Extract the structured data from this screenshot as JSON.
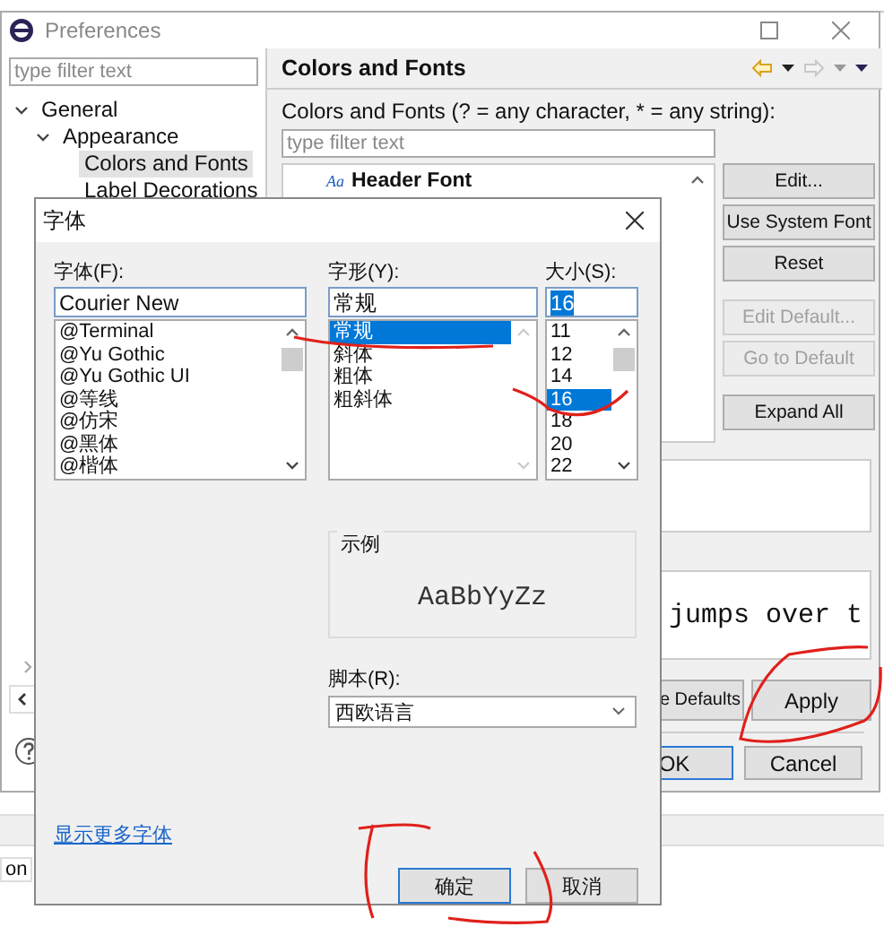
{
  "background": {
    "status_text": "on"
  },
  "preferences": {
    "title": "Preferences",
    "filter": {
      "placeholder": "type filter text"
    },
    "tree": [
      {
        "label": "General",
        "expanded": true,
        "selected": false,
        "children": [
          {
            "label": "Appearance",
            "expanded": true,
            "selected": false,
            "children": [
              {
                "label": "Colors and Fonts",
                "selected": true
              },
              {
                "label": "Label Decorations",
                "selected": false
              }
            ]
          }
        ]
      }
    ],
    "page": {
      "title": "Colors and Fonts",
      "description": "Colors and Fonts (? = any character, * = any string):",
      "filter": {
        "placeholder": "type filter text"
      },
      "items": [
        {
          "icon_text": "Aa",
          "label": "Header Font"
        }
      ],
      "side_buttons": [
        {
          "label": "Edit...",
          "disabled": false
        },
        {
          "label": "Use System Font",
          "disabled": false
        },
        {
          "label": "Reset",
          "disabled": false
        },
        {
          "label": "Edit Default...",
          "disabled": true
        },
        {
          "label": "Go to Default",
          "disabled": true
        },
        {
          "label": "Expand All",
          "disabled": false
        }
      ],
      "preview_text": "jumps over t",
      "buttons": [
        {
          "label": "e Defaults"
        },
        {
          "label": "Apply"
        }
      ]
    },
    "dialog_buttons": [
      {
        "label": "OK",
        "default": true
      },
      {
        "label": "Cancel",
        "default": false
      }
    ]
  },
  "font_dialog": {
    "title": "字体",
    "columns": [
      {
        "label": "字体(F):",
        "value": "Courier New",
        "value_selected": false,
        "options": [
          {
            "label": "@Terminal",
            "selected": false
          },
          {
            "label": "@Yu Gothic",
            "selected": false
          },
          {
            "label": "@Yu Gothic UI",
            "selected": false
          },
          {
            "label": "@等线",
            "selected": false
          },
          {
            "label": "@仿宋",
            "selected": false
          },
          {
            "label": "@黑体",
            "selected": false
          },
          {
            "label": "@楷体",
            "selected": false
          }
        ]
      },
      {
        "label": "字形(Y):",
        "value": "常规",
        "value_selected": false,
        "options": [
          {
            "label": "常规",
            "selected": true
          },
          {
            "label": "斜体",
            "selected": false
          },
          {
            "label": "粗体",
            "selected": false
          },
          {
            "label": "粗斜体",
            "selected": false
          }
        ]
      },
      {
        "label": "大小(S):",
        "value": "16",
        "value_selected": true,
        "options": [
          {
            "label": "11",
            "selected": false
          },
          {
            "label": "12",
            "selected": false
          },
          {
            "label": "14",
            "selected": false
          },
          {
            "label": "16",
            "selected": true
          },
          {
            "label": "18",
            "selected": false
          },
          {
            "label": "20",
            "selected": false
          },
          {
            "label": "22",
            "selected": false
          }
        ]
      }
    ],
    "sample": {
      "label": "示例",
      "text": "AaBbYyZz"
    },
    "script": {
      "label": "脚本(R):",
      "value": "西欧语言"
    },
    "more_fonts_link": "显示更多字体",
    "buttons": [
      {
        "label": "确定",
        "default": true
      },
      {
        "label": "取消",
        "default": false
      }
    ]
  }
}
